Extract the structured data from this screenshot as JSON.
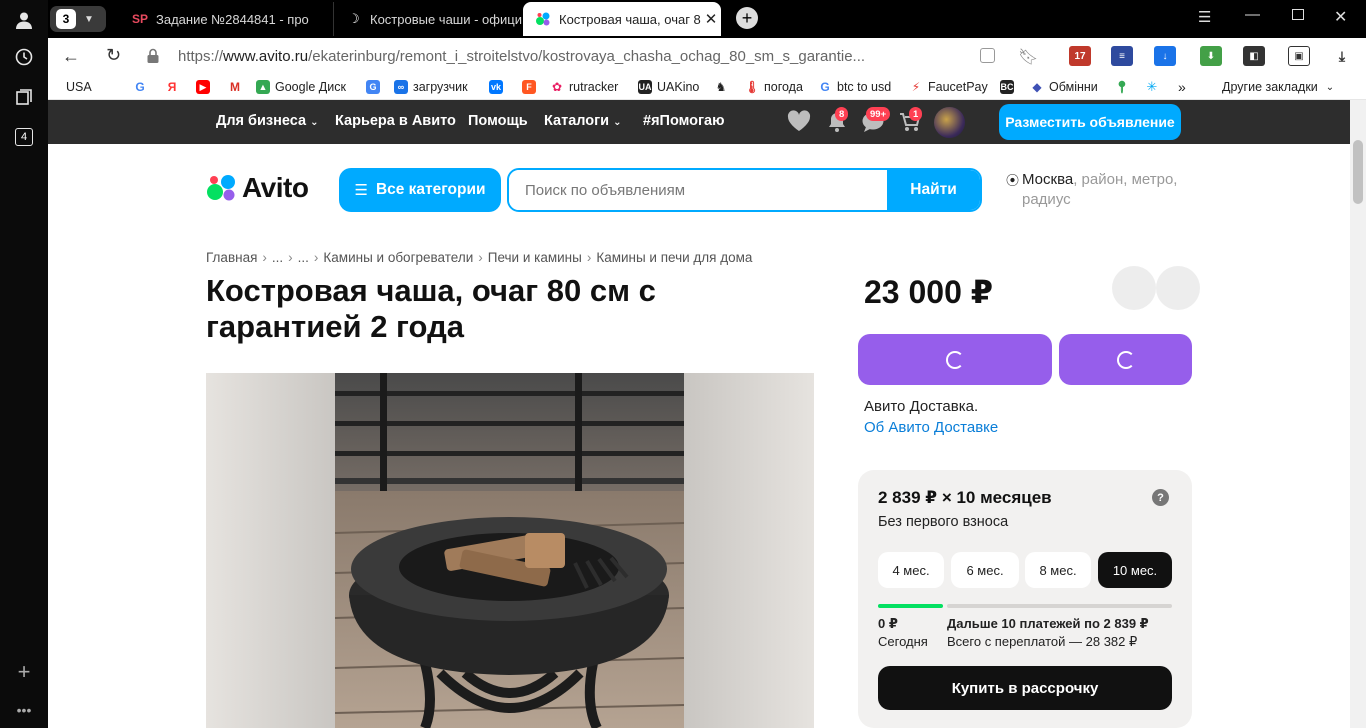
{
  "colors": {
    "avito_blue": "#00aaff",
    "purple": "#965eeb",
    "nav_bg": "#2d2d2d",
    "badge_red": "#ff4053",
    "progress_green": "#04e061"
  },
  "browser": {
    "tab_count": "3",
    "tabs": [
      {
        "label": "Задание №2844841 - про",
        "icon": "sp-logo-icon"
      },
      {
        "label": "Костровые чаши - офици",
        "icon": "moon-icon"
      },
      {
        "label": "Костровая чаша, очаг 80",
        "icon": "avito-icon"
      }
    ],
    "url": {
      "scheme": "https://",
      "domain": "www.avito.ru",
      "path": "/ekaterinburg/remont_i_stroitelstvo/kostrovaya_chasha_ochag_80_sm_s_garantie..."
    },
    "calendar_badge": "17",
    "side_tab_number": "4"
  },
  "bookmarks": {
    "items": [
      "USA",
      "",
      "",
      "",
      "",
      "Google Диск",
      "",
      "загрузчик",
      "",
      "",
      "rutracker",
      "UAKino",
      "",
      "погода",
      "btc to usd",
      "FaucetPay",
      "",
      "Обмінни",
      "",
      ""
    ],
    "other": "Другие закладки"
  },
  "site": {
    "nav": {
      "business": "Для бизнеса",
      "career": "Карьера в Авито",
      "help": "Помощь",
      "catalogs": "Каталоги",
      "help_tag": "#яПомогаю"
    },
    "badges": {
      "notifications": "8",
      "messages": "99+",
      "cart": "1"
    },
    "post_ad": "Разместить объявление",
    "logo": "Avito",
    "all_categories": "Все категории",
    "search_placeholder": "Поиск по объявлениям",
    "search_button": "Найти",
    "location_city": "Москва",
    "location_rest": ", район, метро, радиус"
  },
  "breadcrumbs": [
    "Главная",
    "...",
    "...",
    "Камины и обогреватели",
    "Печи и камины",
    "Камины и печи для дома"
  ],
  "listing": {
    "title": "Костровая чаша, очаг 80 см с гарантией 2 года",
    "price": "23 000 ₽",
    "delivery_text": "Авито Доставка.",
    "delivery_link": "Об Авито Доставке"
  },
  "installment": {
    "headline": "2 839 ₽ × 10 месяцев",
    "subtitle": "Без первого взноса",
    "terms": [
      "4 мес.",
      "6 мес.",
      "8 мес.",
      "10 мес."
    ],
    "selected_term": "10 мес.",
    "today_amount": "0 ₽",
    "today_label": "Сегодня",
    "next_label": "Дальше 10 платежей по 2 839 ₽",
    "total_label": "Всего с переплатой — 28 382 ₽",
    "buy_button": "Купить в рассрочку"
  }
}
